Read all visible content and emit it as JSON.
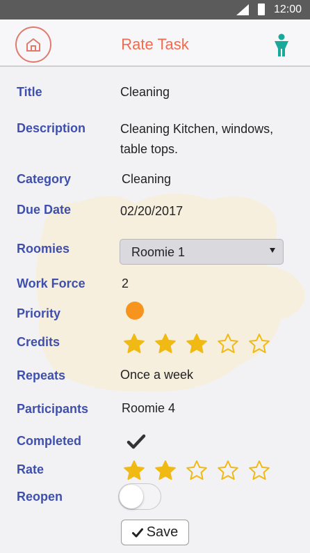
{
  "status_bar": {
    "time": "12:00"
  },
  "app_bar": {
    "title": "Rate Task"
  },
  "colors": {
    "accent": "#f26a4d",
    "label": "#3f4fae",
    "star": "#f0b913",
    "priority": "#f7941d",
    "profile": "#19a89a"
  },
  "fields": {
    "title_label": "Title",
    "title_value": "Cleaning",
    "description_label": "Description",
    "description_line1": "Cleaning Kitchen, windows,",
    "description_line2": "table tops.",
    "category_label": "Category",
    "category_value": "Cleaning",
    "due_date_label": "Due Date",
    "due_date_value": "02/20/2017",
    "roomies_label": "Roomies",
    "roomies_selected": "Roomie 1",
    "work_force_label": "Work Force",
    "work_force_value": "2",
    "priority_label": "Priority",
    "credits_label": "Credits",
    "credits_rating": 3,
    "credits_max": 5,
    "repeats_label": "Repeats",
    "repeats_value": "Once a week",
    "participants_label": "Participants",
    "participants_value": "Roomie 4",
    "completed_label": "Completed",
    "completed": true,
    "rate_label": "Rate",
    "rate_rating": 2,
    "rate_max": 5,
    "reopen_label": "Reopen",
    "reopen_on": false
  },
  "actions": {
    "save_label": "Save"
  },
  "icons": {
    "logo": "home-logo-icon",
    "profile": "person-icon",
    "priority": "priority-dot-icon",
    "star": "star-icon",
    "check": "check-icon"
  }
}
